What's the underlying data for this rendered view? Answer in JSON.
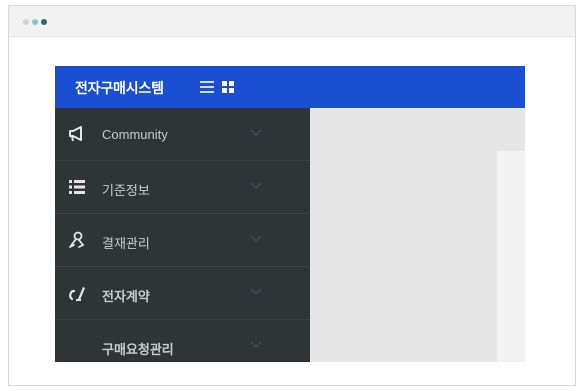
{
  "app": {
    "title": "전자구매시스템"
  },
  "colors": {
    "header_blue": "#1a4fd1",
    "sidebar_bg": "#2f3437",
    "content_bg": "#e6e6e6"
  },
  "sidebar": {
    "items": [
      {
        "label": "Community",
        "icon": "megaphone-icon"
      },
      {
        "label": "기준정보",
        "icon": "list-icon"
      },
      {
        "label": "결재관리",
        "icon": "approval-icon"
      },
      {
        "label": "전자계약",
        "icon": "contract-icon"
      },
      {
        "label": "구매요청관리",
        "icon": ""
      }
    ]
  }
}
